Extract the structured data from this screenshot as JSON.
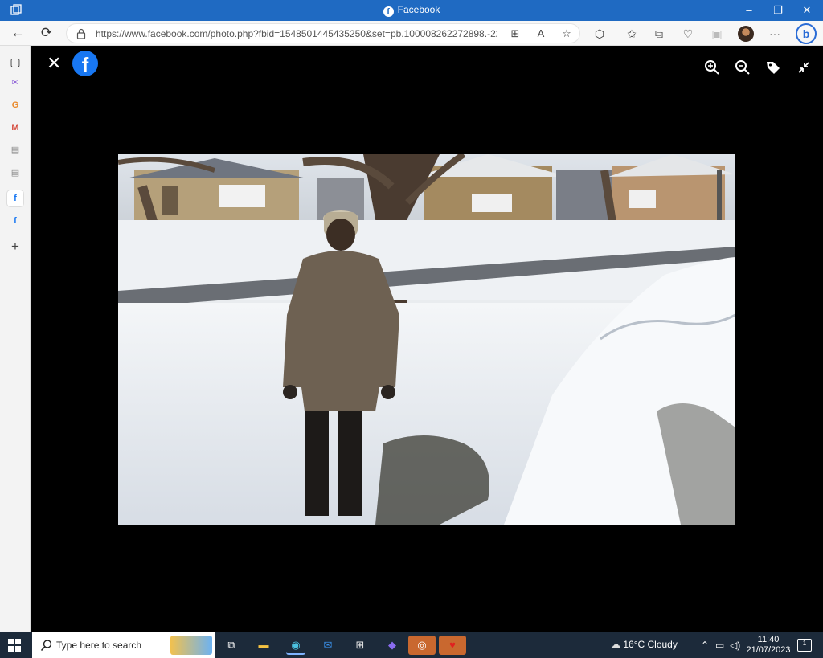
{
  "window": {
    "title": "Facebook",
    "minimize": "–",
    "restore": "❐",
    "close": "✕"
  },
  "address": {
    "url": "https://www.facebook.com/photo.php?fbid=1548501445435250&set=pb.100008262272898.-22075..."
  },
  "viewer": {
    "fb_letter": "f",
    "close": "✕"
  },
  "taskbar": {
    "search_placeholder": "Type here to search",
    "weather": "16°C  Cloudy",
    "time": "11:40",
    "date": "21/07/2023",
    "notif_count": "1"
  },
  "colors": {
    "titlebar": "#1f6ac2",
    "facebook_blue": "#1877f2",
    "taskbar": "#1c2a3a"
  }
}
